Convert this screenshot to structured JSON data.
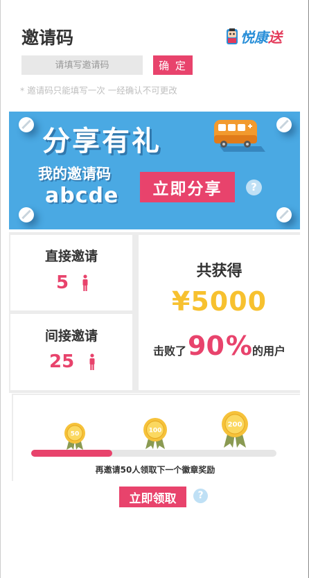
{
  "header": {
    "title": "邀请码",
    "logo_text_blue": "悦康",
    "logo_text_red": "送"
  },
  "invite": {
    "placeholder": "请填写邀请码",
    "confirm_label": "确 定",
    "note": "* 邀请码只能填写一次   一经确认不可更改"
  },
  "banner": {
    "title": "分享有礼",
    "code_label": "我的邀请码",
    "code": "abcde",
    "share_label": "立即分享",
    "help_glyph": "?"
  },
  "stats": {
    "direct_label": "直接邀请",
    "direct_count": "5",
    "indirect_label": "间接邀请",
    "indirect_count": "25",
    "total_label": "共获得",
    "total_amount": "¥5000",
    "beat_prefix": "击败了",
    "beat_number": "90",
    "beat_percent_sign": "%",
    "beat_suffix": "的用户"
  },
  "badges": {
    "items": [
      {
        "label": "50"
      },
      {
        "label": "100"
      },
      {
        "label": "200"
      }
    ],
    "progress_fraction": 0.33,
    "note": "再邀请50人领取下一个徽章奖励"
  },
  "claim": {
    "label": "立即领取",
    "help_glyph": "?"
  },
  "colors": {
    "accent": "#e8436c",
    "banner_blue": "#4aa9e3",
    "gold": "#f7c12f"
  },
  "icons": {
    "help": "help-icon",
    "person": "person-icon",
    "badge": "medal-badge-icon",
    "bus": "bus-icon",
    "pill": "pill-icon"
  }
}
